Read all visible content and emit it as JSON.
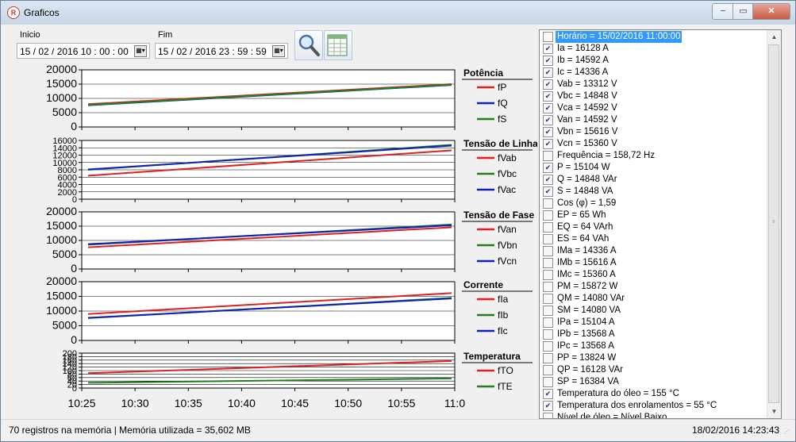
{
  "window": {
    "title": "Graficos",
    "minimize": "−",
    "maximize": "▭",
    "close": "✕"
  },
  "filters": {
    "start_label": "Inicio",
    "start_value": "15 / 02 / 2016   10 : 00 : 00",
    "end_label": "Fim",
    "end_value": "15 / 02 / 2016   23 : 59 : 59",
    "search_icon": "magnifier-icon",
    "table_icon": "spreadsheet-icon"
  },
  "chart_data": [
    {
      "type": "line",
      "title": "Potência",
      "ylim": [
        0,
        20000
      ],
      "yticks": [
        "20000",
        "15000",
        "10000",
        "5000",
        "0"
      ],
      "x": [
        "10:25",
        "11:00"
      ],
      "series": [
        {
          "name": "fP",
          "color": "#e02020",
          "values": [
            8000,
            15000
          ]
        },
        {
          "name": "fQ",
          "color": "#1020c0",
          "values": [
            7600,
            14700
          ]
        },
        {
          "name": "fS",
          "color": "#208020",
          "values": [
            7700,
            14800
          ]
        }
      ]
    },
    {
      "type": "line",
      "title": "Tensão de Linha",
      "ylim": [
        0,
        16000
      ],
      "yticks": [
        "16000",
        "14000",
        "12000",
        "10000",
        "8000",
        "6000",
        "4000",
        "2000",
        "0"
      ],
      "x": [
        "10:25",
        "11:00"
      ],
      "series": [
        {
          "name": "fVab",
          "color": "#e02020",
          "values": [
            6400,
            13300
          ]
        },
        {
          "name": "fVbc",
          "color": "#208020",
          "values": [
            8000,
            14800
          ]
        },
        {
          "name": "fVac",
          "color": "#1020c0",
          "values": [
            8100,
            14600
          ]
        }
      ]
    },
    {
      "type": "line",
      "title": "Tensão de Fase",
      "ylim": [
        0,
        20000
      ],
      "yticks": [
        "20000",
        "15000",
        "10000",
        "5000",
        "0"
      ],
      "x": [
        "10:25",
        "11:00"
      ],
      "series": [
        {
          "name": "fVan",
          "color": "#e02020",
          "values": [
            7600,
            14600
          ]
        },
        {
          "name": "fVbn",
          "color": "#208020",
          "values": [
            8500,
            15600
          ]
        },
        {
          "name": "fVcn",
          "color": "#1020c0",
          "values": [
            8700,
            15300
          ]
        }
      ]
    },
    {
      "type": "line",
      "title": "Corrente",
      "ylim": [
        0,
        20000
      ],
      "yticks": [
        "20000",
        "15000",
        "10000",
        "5000",
        "0"
      ],
      "x": [
        "10:25",
        "11:00"
      ],
      "series": [
        {
          "name": "fIa",
          "color": "#e02020",
          "values": [
            9000,
            16100
          ]
        },
        {
          "name": "fIb",
          "color": "#208020",
          "values": [
            7600,
            14500
          ]
        },
        {
          "name": "fIc",
          "color": "#1020c0",
          "values": [
            7700,
            14300
          ]
        }
      ]
    },
    {
      "type": "line",
      "title": "Temperatura",
      "ylim": [
        0,
        200
      ],
      "yticks": [
        "200",
        "180",
        "160",
        "140",
        "120",
        "100",
        "80",
        "60",
        "40",
        "20",
        "0"
      ],
      "x": [
        "10:25",
        "11:00"
      ],
      "series": [
        {
          "name": "fTO",
          "color": "#e02020",
          "values": [
            85,
            155
          ]
        },
        {
          "name": "fTE",
          "color": "#208020",
          "values": [
            30,
            55
          ]
        }
      ]
    }
  ],
  "x_ticks": [
    "10:25",
    "10:30",
    "10:35",
    "10:40",
    "10:45",
    "10:50",
    "10:55",
    "11:0"
  ],
  "list_items": [
    {
      "text": "Horário = 15/02/2016 11:00:00",
      "checked": false,
      "selected": true
    },
    {
      "text": "Ia = 16128 A",
      "checked": true
    },
    {
      "text": "Ib = 14592 A",
      "checked": true
    },
    {
      "text": "Ic = 14336 A",
      "checked": true
    },
    {
      "text": "Vab = 13312 V",
      "checked": true
    },
    {
      "text": "Vbc = 14848 V",
      "checked": true
    },
    {
      "text": "Vca = 14592 V",
      "checked": true
    },
    {
      "text": "Van = 14592 V",
      "checked": true
    },
    {
      "text": "Vbn = 15616 V",
      "checked": true
    },
    {
      "text": "Vcn = 15360 V",
      "checked": true
    },
    {
      "text": "Frequência = 158,72 Hz",
      "checked": false
    },
    {
      "text": "P = 15104 W",
      "checked": true
    },
    {
      "text": "Q = 14848 VAr",
      "checked": true
    },
    {
      "text": "S = 14848 VA",
      "checked": true
    },
    {
      "text": "Cos (φ) = 1,59",
      "checked": false
    },
    {
      "text": "EP = 65 Wh",
      "checked": false
    },
    {
      "text": "EQ = 64 VArh",
      "checked": false
    },
    {
      "text": "ES = 64 VAh",
      "checked": false
    },
    {
      "text": "IMa = 14336 A",
      "checked": false
    },
    {
      "text": "IMb = 15616 A",
      "checked": false
    },
    {
      "text": "IMc = 15360 A",
      "checked": false
    },
    {
      "text": "PM = 15872 W",
      "checked": false
    },
    {
      "text": "QM = 14080 VAr",
      "checked": false
    },
    {
      "text": "SM = 14080 VA",
      "checked": false
    },
    {
      "text": "IPa = 15104 A",
      "checked": false
    },
    {
      "text": "IPb = 13568 A",
      "checked": false
    },
    {
      "text": "IPc = 13568 A",
      "checked": false
    },
    {
      "text": "PP = 13824 W",
      "checked": false
    },
    {
      "text": "QP = 16128 VAr",
      "checked": false
    },
    {
      "text": "SP = 16384 VA",
      "checked": false
    },
    {
      "text": "Temperatura do óleo = 155 °C",
      "checked": true
    },
    {
      "text": "Temperatura dos enrolamentos = 55 °C",
      "checked": true
    },
    {
      "text": "Nível de óleo = Nível Baixo",
      "checked": false
    }
  ],
  "status": {
    "left": "70 registros na memória | Memória utilizada = 35,602 MB",
    "right": "18/02/2016 14:23:43"
  }
}
